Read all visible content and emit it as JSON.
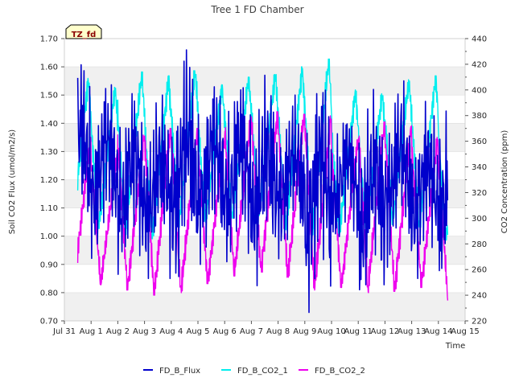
{
  "chart_data": {
    "type": "line",
    "title": "Tree 1 FD Chamber",
    "badge": "TZ_fd",
    "xlabel": "Time",
    "ylabel_left": "Soil CO2 Flux (umol/m2/s)",
    "ylabel_right": "CO2 Concentration (ppm)",
    "x_ticks": [
      "Jul 31",
      "Aug 1",
      "Aug 2",
      "Aug 3",
      "Aug 4",
      "Aug 5",
      "Aug 6",
      "Aug 7",
      "Aug 8",
      "Aug 9",
      "Aug 10",
      "Aug 11",
      "Aug 12",
      "Aug 13",
      "Aug 14",
      "Aug 15"
    ],
    "x_range_days": [
      0,
      15
    ],
    "ylim_left": [
      0.7,
      1.7
    ],
    "ylim_right": [
      220,
      440
    ],
    "y_ticks_left": [
      "0.70",
      "0.80",
      "0.90",
      "1.00",
      "1.10",
      "1.20",
      "1.30",
      "1.40",
      "1.50",
      "1.60",
      "1.70"
    ],
    "y_ticks_right": [
      "220",
      "240",
      "260",
      "280",
      "300",
      "320",
      "340",
      "360",
      "380",
      "400",
      "420",
      "440"
    ],
    "grid": "horizontal alternating bands",
    "legend_position": "bottom-center",
    "series": [
      {
        "name": "FD_B_Flux",
        "axis": "left",
        "color": "#0000cc",
        "day_peaks": [
          1.62,
          1.56,
          1.52,
          1.5,
          1.66,
          1.56,
          1.57,
          1.57,
          1.5,
          1.59,
          1.45,
          1.52,
          1.55,
          1.48,
          1.57
        ],
        "day_lows": [
          0.93,
          0.92,
          0.86,
          0.85,
          0.81,
          0.9,
          0.88,
          0.82,
          0.92,
          0.73,
          0.95,
          0.74,
          0.89,
          0.85,
          0.83
        ]
      },
      {
        "name": "FD_B_CO2_1",
        "axis": "right",
        "color": "#00eeee",
        "day_peaks": [
          409,
          402,
          414,
          411,
          415,
          404,
          410,
          412,
          418,
          424,
          400,
          397,
          408,
          411,
          392
        ],
        "day_lows": [
          290,
          292,
          287,
          284,
          293,
          297,
          300,
          302,
          291,
          287,
          286,
          292,
          295,
          293,
          283
        ]
      },
      {
        "name": "FD_B_CO2_2",
        "axis": "right",
        "color": "#ee00ee",
        "day_peaks": [
          363,
          350,
          365,
          370,
          370,
          362,
          377,
          383,
          381,
          380,
          361,
          375,
          372,
          363,
          350
        ],
        "day_lows": [
          250,
          248,
          244,
          240,
          242,
          249,
          255,
          258,
          254,
          244,
          246,
          242,
          243,
          246,
          234
        ]
      }
    ]
  }
}
